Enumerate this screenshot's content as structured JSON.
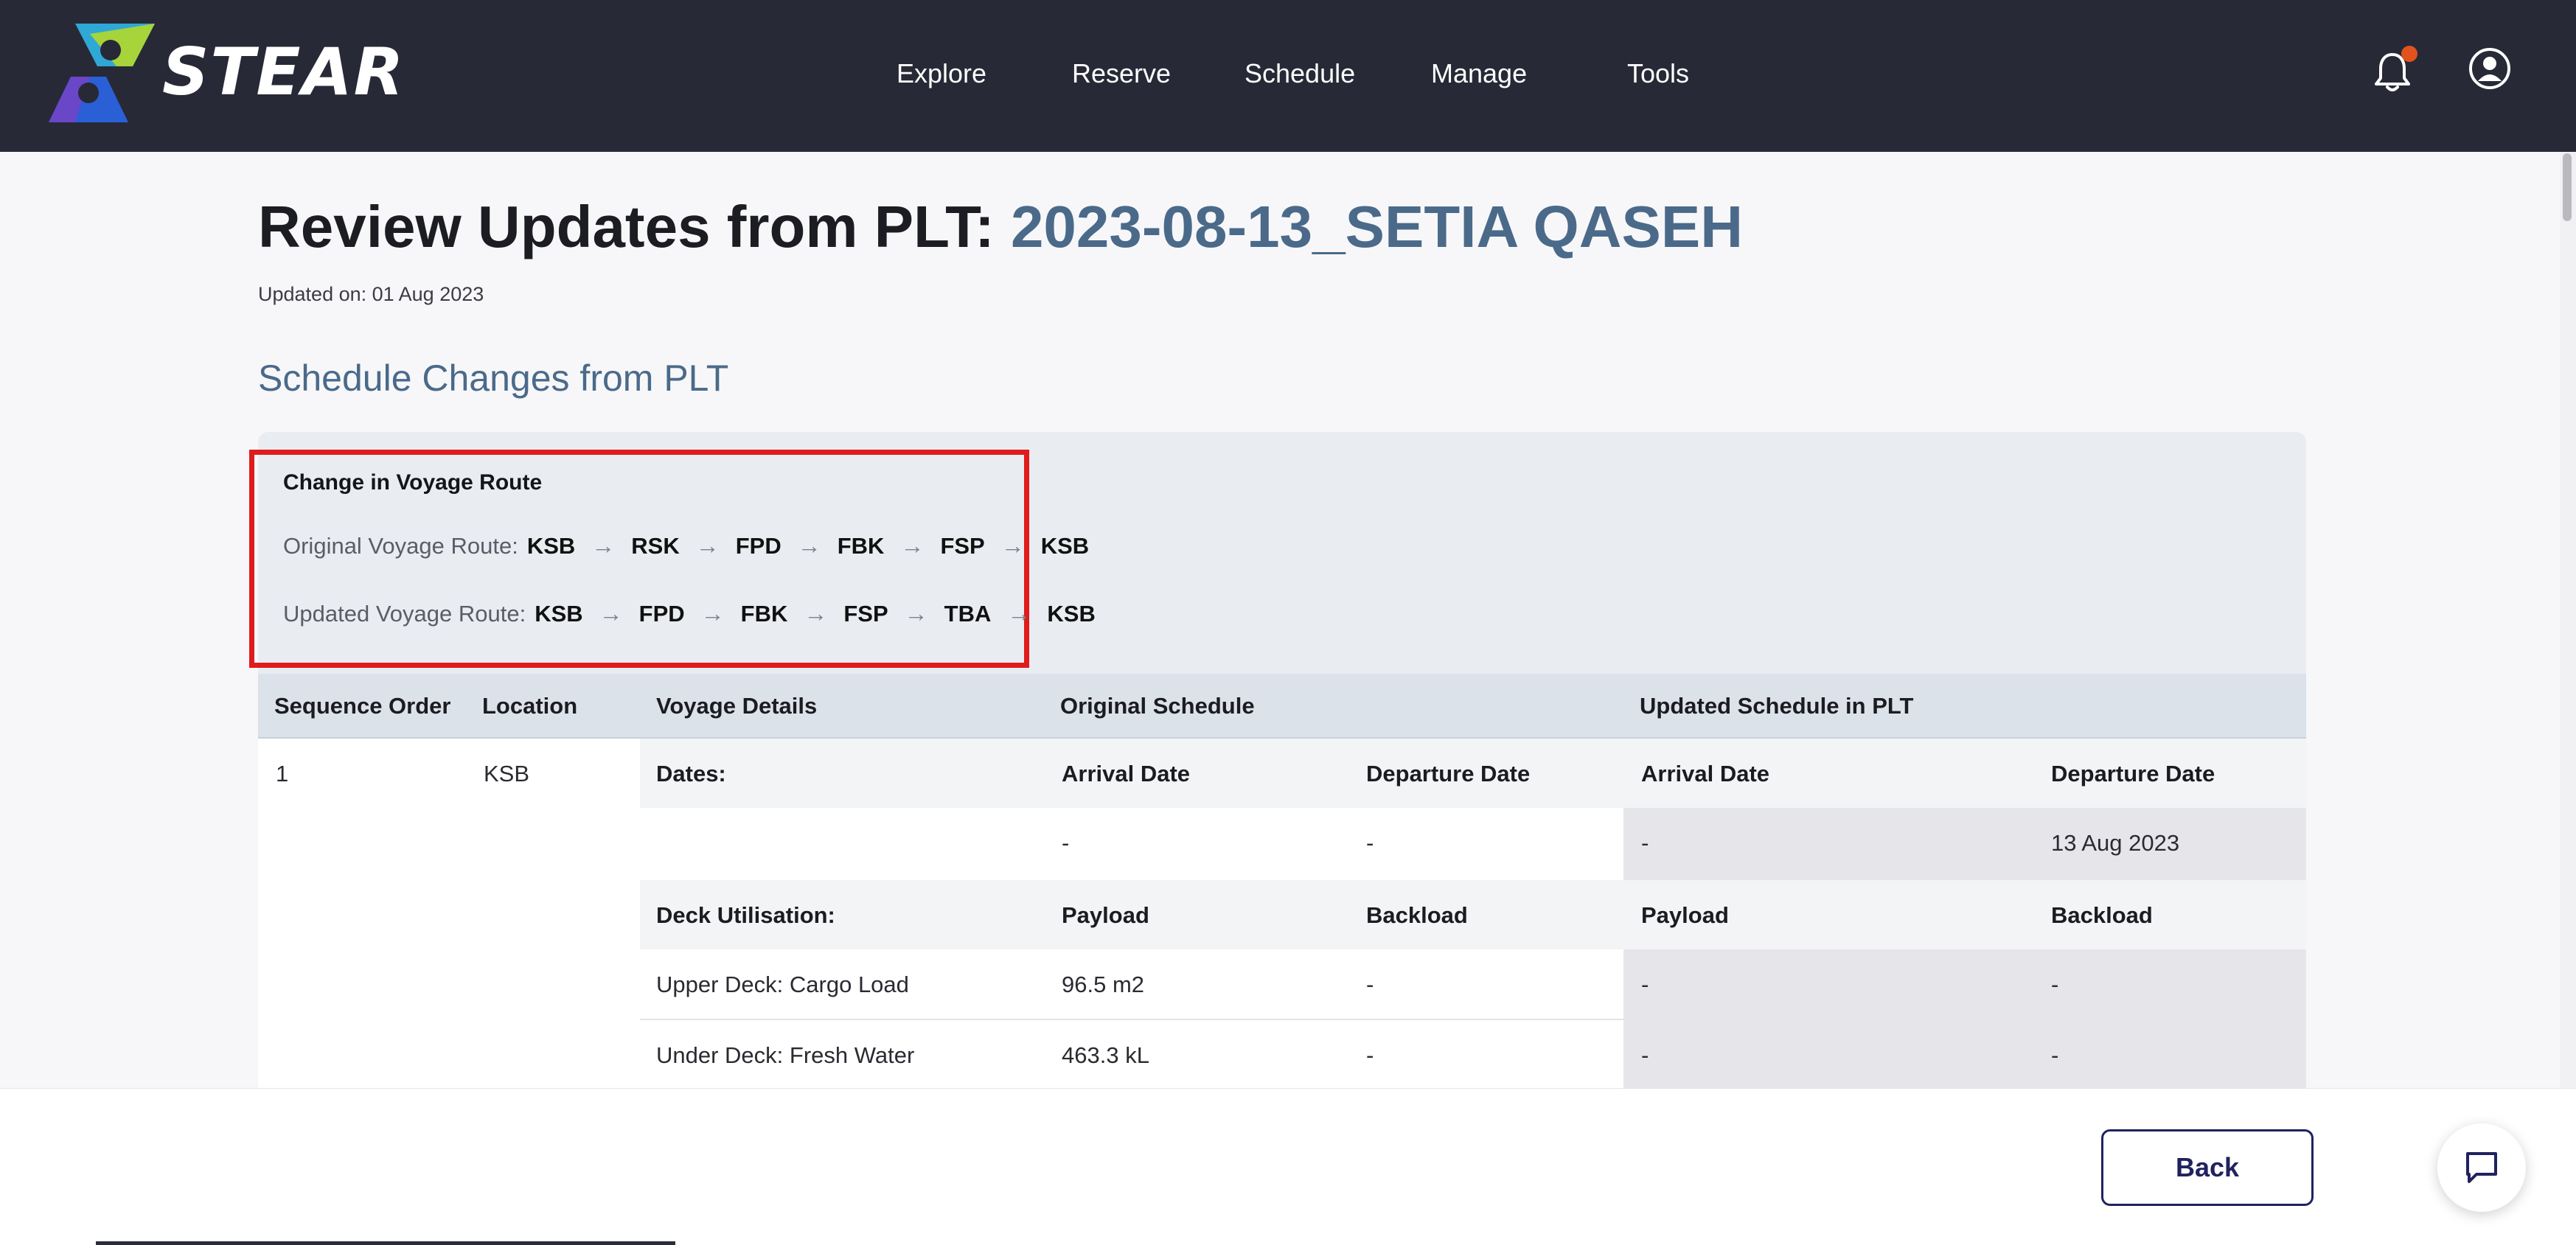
{
  "brand": {
    "name": "STEAR"
  },
  "nav": {
    "items": [
      "Explore",
      "Reserve",
      "Schedule",
      "Manage",
      "Tools"
    ]
  },
  "header_icons": {
    "notifications": "bell-icon",
    "account": "user-circle-icon",
    "notification_dot_color": "#e2521d"
  },
  "page": {
    "title_prefix": "Review Updates from PLT: ",
    "title_accent": "2023-08-13_SETIA QASEH",
    "updated": "Updated on: 01 Aug 2023",
    "section_title": "Schedule Changes from PLT"
  },
  "route_change": {
    "heading": "Change in Voyage Route",
    "original_label": "Original Voyage Route:",
    "original_stops": [
      "KSB",
      "RSK",
      "FPD",
      "FBK",
      "FSP",
      "KSB"
    ],
    "updated_label": "Updated Voyage Route:",
    "updated_stops": [
      "KSB",
      "FPD",
      "FBK",
      "FSP",
      "TBA",
      "KSB"
    ]
  },
  "table": {
    "headers": {
      "sequence": "Sequence Order",
      "location": "Location",
      "voyage_details": "Voyage Details",
      "original": "Original Schedule",
      "updated": "Updated Schedule in PLT"
    },
    "row": {
      "sequence": "1",
      "location": "KSB",
      "dates_label": "Dates:",
      "arrival_label": "Arrival Date",
      "departure_label": "Departure Date",
      "orig_arrival": "-",
      "orig_departure": "-",
      "upd_arrival": "-",
      "upd_departure": "13 Aug 2023",
      "deck_label": "Deck Utilisation:",
      "payload_label": "Payload",
      "backload_label": "Backload",
      "items": [
        {
          "label": "Upper Deck: Cargo Load",
          "orig_payload": "96.5 m2",
          "orig_backload": "-",
          "upd_payload": "-",
          "upd_backload": "-"
        },
        {
          "label": "Under Deck: Fresh Water",
          "orig_payload": "463.3 kL",
          "orig_backload": "-",
          "upd_payload": "-",
          "upd_backload": "-"
        }
      ]
    }
  },
  "footer": {
    "back_label": "Back",
    "chat_icon": "chat-icon"
  },
  "colors": {
    "topbar": "#272936",
    "accent": "#4b6a8a",
    "highlight_border": "#e01b1b",
    "button": "#20225f"
  }
}
